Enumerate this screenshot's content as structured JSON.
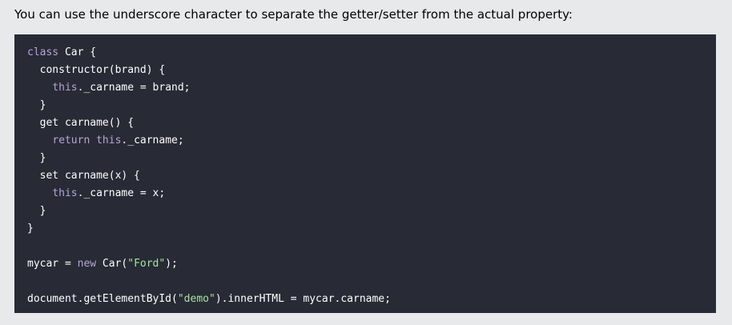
{
  "intro_text": "You can use the underscore character to separate the getter/setter from the actual property:",
  "code": {
    "lines": [
      {
        "indent": "",
        "tokens": [
          {
            "t": "class",
            "k": "kw"
          },
          {
            "t": " Car {",
            "k": "plain"
          }
        ]
      },
      {
        "indent": "  ",
        "tokens": [
          {
            "t": "constructor(brand) {",
            "k": "plain"
          }
        ]
      },
      {
        "indent": "    ",
        "tokens": [
          {
            "t": "this",
            "k": "kw"
          },
          {
            "t": "._carname = brand;",
            "k": "plain"
          }
        ]
      },
      {
        "indent": "  ",
        "tokens": [
          {
            "t": "}",
            "k": "plain"
          }
        ]
      },
      {
        "indent": "  ",
        "tokens": [
          {
            "t": "get carname() {",
            "k": "plain"
          }
        ]
      },
      {
        "indent": "    ",
        "tokens": [
          {
            "t": "return",
            "k": "kw"
          },
          {
            "t": " ",
            "k": "plain"
          },
          {
            "t": "this",
            "k": "kw"
          },
          {
            "t": "._carname;",
            "k": "plain"
          }
        ]
      },
      {
        "indent": "  ",
        "tokens": [
          {
            "t": "}",
            "k": "plain"
          }
        ]
      },
      {
        "indent": "  ",
        "tokens": [
          {
            "t": "set carname(x) {",
            "k": "plain"
          }
        ]
      },
      {
        "indent": "    ",
        "tokens": [
          {
            "t": "this",
            "k": "kw"
          },
          {
            "t": "._carname = x;",
            "k": "plain"
          }
        ]
      },
      {
        "indent": "  ",
        "tokens": [
          {
            "t": "}",
            "k": "plain"
          }
        ]
      },
      {
        "indent": "",
        "tokens": [
          {
            "t": "}",
            "k": "plain"
          }
        ]
      },
      {
        "indent": "",
        "tokens": []
      },
      {
        "indent": "",
        "tokens": [
          {
            "t": "mycar = ",
            "k": "plain"
          },
          {
            "t": "new",
            "k": "kw"
          },
          {
            "t": " Car(",
            "k": "plain"
          },
          {
            "t": "\"Ford\"",
            "k": "str"
          },
          {
            "t": ");",
            "k": "plain"
          }
        ]
      },
      {
        "indent": "",
        "tokens": []
      },
      {
        "indent": "",
        "tokens": [
          {
            "t": "document.getElementById(",
            "k": "plain"
          },
          {
            "t": "\"demo\"",
            "k": "str"
          },
          {
            "t": ").innerHTML = mycar.carname;",
            "k": "plain"
          }
        ]
      }
    ]
  },
  "colors": {
    "page_background": "#e7e9eb",
    "code_background": "#282a35",
    "keyword": "#b4a5d8",
    "string": "#a6e3a1",
    "text": "#ffffff"
  }
}
